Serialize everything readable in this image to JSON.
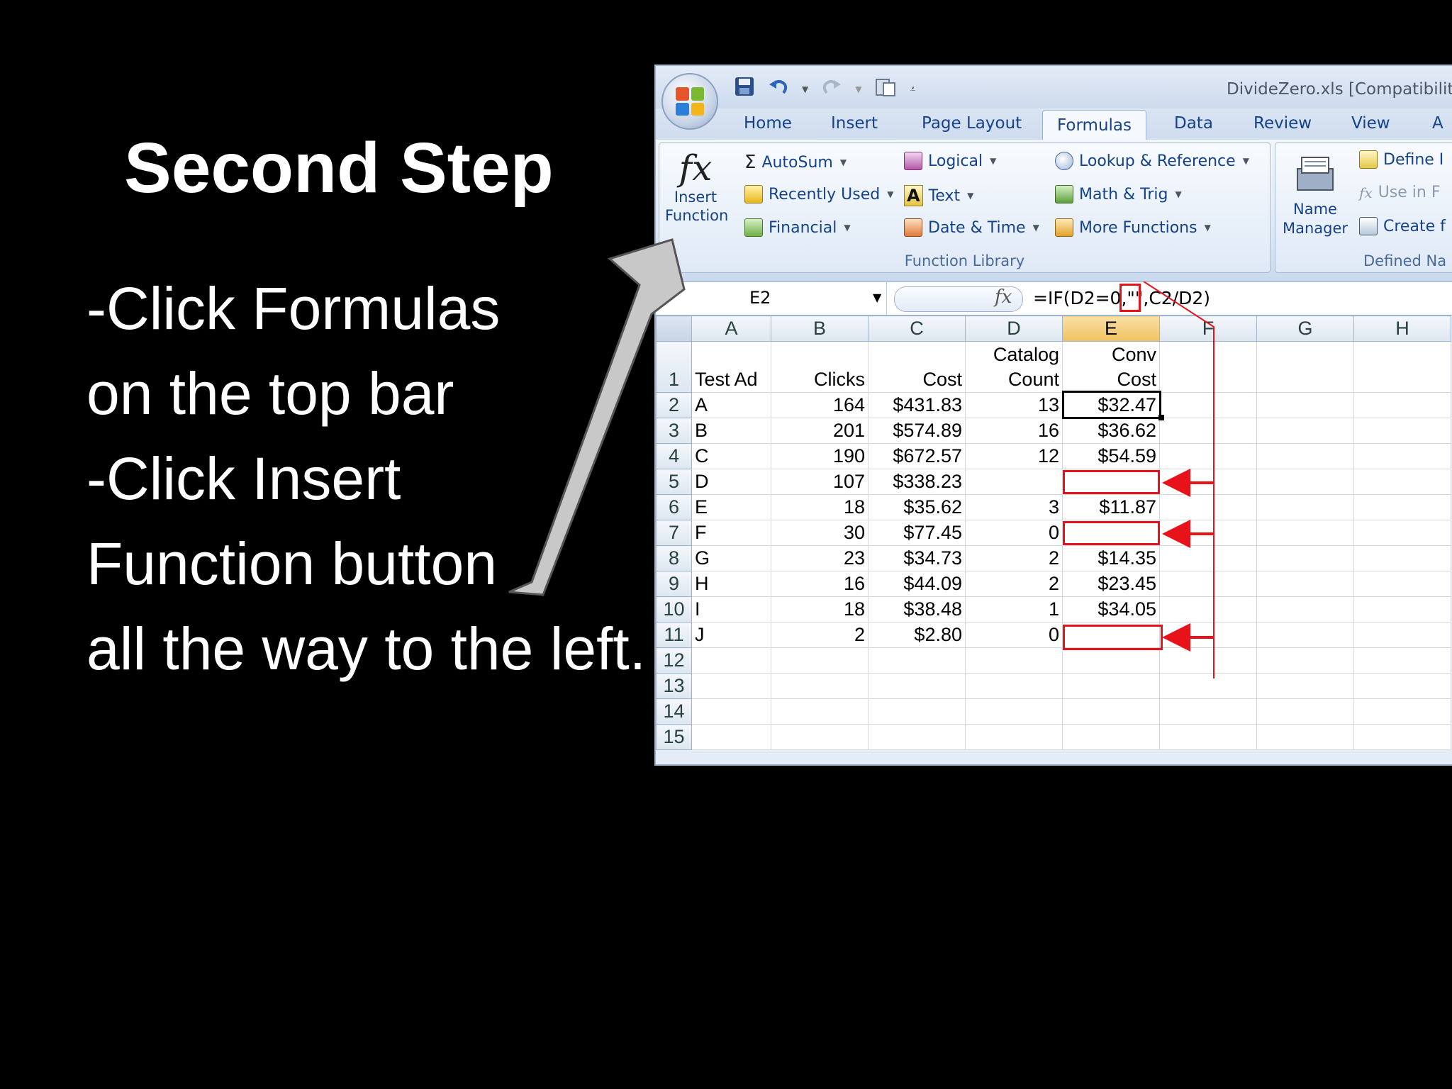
{
  "slide": {
    "title": "Second Step",
    "lines": [
      "-Click Formulas",
      " on the top bar",
      "-Click Insert",
      "Function button",
      "all the way to the left."
    ]
  },
  "excel": {
    "window_title": "DivideZero.xls  [Compatibility",
    "tabs": [
      "Home",
      "Insert",
      "Page Layout",
      "Formulas",
      "Data",
      "Review",
      "View",
      "A"
    ],
    "active_tab": "Formulas",
    "ribbon": {
      "insert_function": {
        "line1": "Insert",
        "line2": "Function"
      },
      "autosum": "AutoSum",
      "recently_used": "Recently Used",
      "financial": "Financial",
      "logical": "Logical",
      "text": "Text",
      "date_time": "Date & Time",
      "lookup_reference": "Lookup & Reference",
      "math_trig": "Math & Trig",
      "more_functions": "More Functions",
      "function_library_label": "Function Library",
      "name_manager": {
        "line1": "Name",
        "line2": "Manager"
      },
      "define_name": "Define I",
      "use_in_formula": "Use in F",
      "create_from": "Create f",
      "defined_names_label": "Defined Na"
    },
    "name_box": "E2",
    "fx_symbol": "fx",
    "formula": "=IF(D2=0,\"\",C2/D2)",
    "columns": [
      "A",
      "B",
      "C",
      "D",
      "E",
      "F",
      "G",
      "H"
    ],
    "header_row": {
      "a": "Test Ad",
      "b": "Clicks",
      "c": "Cost",
      "d1": "Catalog",
      "d2": "Count",
      "e1": "Conv",
      "e2": "Cost"
    },
    "rows": [
      {
        "n": "2",
        "a": "A",
        "b": "164",
        "c": "$431.83",
        "d": "13",
        "e": "$32.47"
      },
      {
        "n": "3",
        "a": "B",
        "b": "201",
        "c": "$574.89",
        "d": "16",
        "e": "$36.62"
      },
      {
        "n": "4",
        "a": "C",
        "b": "190",
        "c": "$672.57",
        "d": "12",
        "e": "$54.59"
      },
      {
        "n": "5",
        "a": "D",
        "b": "107",
        "c": "$338.23",
        "d": "",
        "e": ""
      },
      {
        "n": "6",
        "a": "E",
        "b": "18",
        "c": "$35.62",
        "d": "3",
        "e": "$11.87"
      },
      {
        "n": "7",
        "a": "F",
        "b": "30",
        "c": "$77.45",
        "d": "0",
        "e": ""
      },
      {
        "n": "8",
        "a": "G",
        "b": "23",
        "c": "$34.73",
        "d": "2",
        "e": "$14.35"
      },
      {
        "n": "9",
        "a": "H",
        "b": "16",
        "c": "$44.09",
        "d": "2",
        "e": "$23.45"
      },
      {
        "n": "10",
        "a": "I",
        "b": "18",
        "c": "$38.48",
        "d": "1",
        "e": "$34.05"
      },
      {
        "n": "11",
        "a": "J",
        "b": "2",
        "c": "$2.80",
        "d": "0",
        "e": ""
      },
      {
        "n": "12",
        "a": "",
        "b": "",
        "c": "",
        "d": "",
        "e": ""
      },
      {
        "n": "13",
        "a": "",
        "b": "",
        "c": "",
        "d": "",
        "e": ""
      },
      {
        "n": "14",
        "a": "",
        "b": "",
        "c": "",
        "d": "",
        "e": ""
      },
      {
        "n": "15",
        "a": "",
        "b": "",
        "c": "",
        "d": "",
        "e": ""
      }
    ],
    "row1_number": "1"
  },
  "colors": {
    "highlight_red": "#e8121b",
    "arrow_gray": "#c8c8c8",
    "ribbon_text": "#15428b"
  }
}
